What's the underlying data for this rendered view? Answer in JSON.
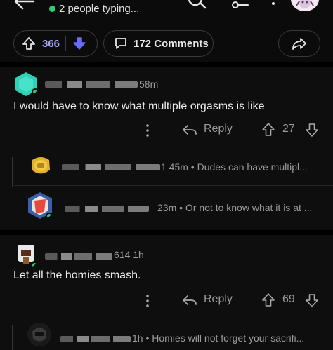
{
  "header": {
    "typing_status": "2 people typing..."
  },
  "post_actions": {
    "upvote_count": "366",
    "comments_label": "172 Comments"
  },
  "comments": [
    {
      "meta": "58m",
      "body": "I would have to know what multiple orgasms is like",
      "reply_label": "Reply",
      "score": "27",
      "replies": [
        {
          "meta": "1 45m • Dudes can have multipl..."
        },
        {
          "meta": "23m • Or not to know what it is at ..."
        }
      ]
    },
    {
      "meta": "614 1h",
      "body": "Let all the homies smash.",
      "reply_label": "Reply",
      "score": "69",
      "replies": [
        {
          "meta": "1h • Homies will not forget your sacrifi..."
        }
      ]
    }
  ],
  "icons": {
    "back": "arrow-left-icon",
    "search": "search-icon",
    "key": "key-icon",
    "more": "more-vertical-icon",
    "upvote": "arrow-up-icon",
    "downvote": "arrow-down-icon",
    "comments": "comment-bubble-icon",
    "share": "share-icon",
    "reply": "reply-icon"
  },
  "colors": {
    "upvote_active": "#a8a7ff",
    "downvote_active": "#6a6cff",
    "online": "#2ecc71",
    "background": "#000000",
    "card": "#0e0e0e"
  }
}
